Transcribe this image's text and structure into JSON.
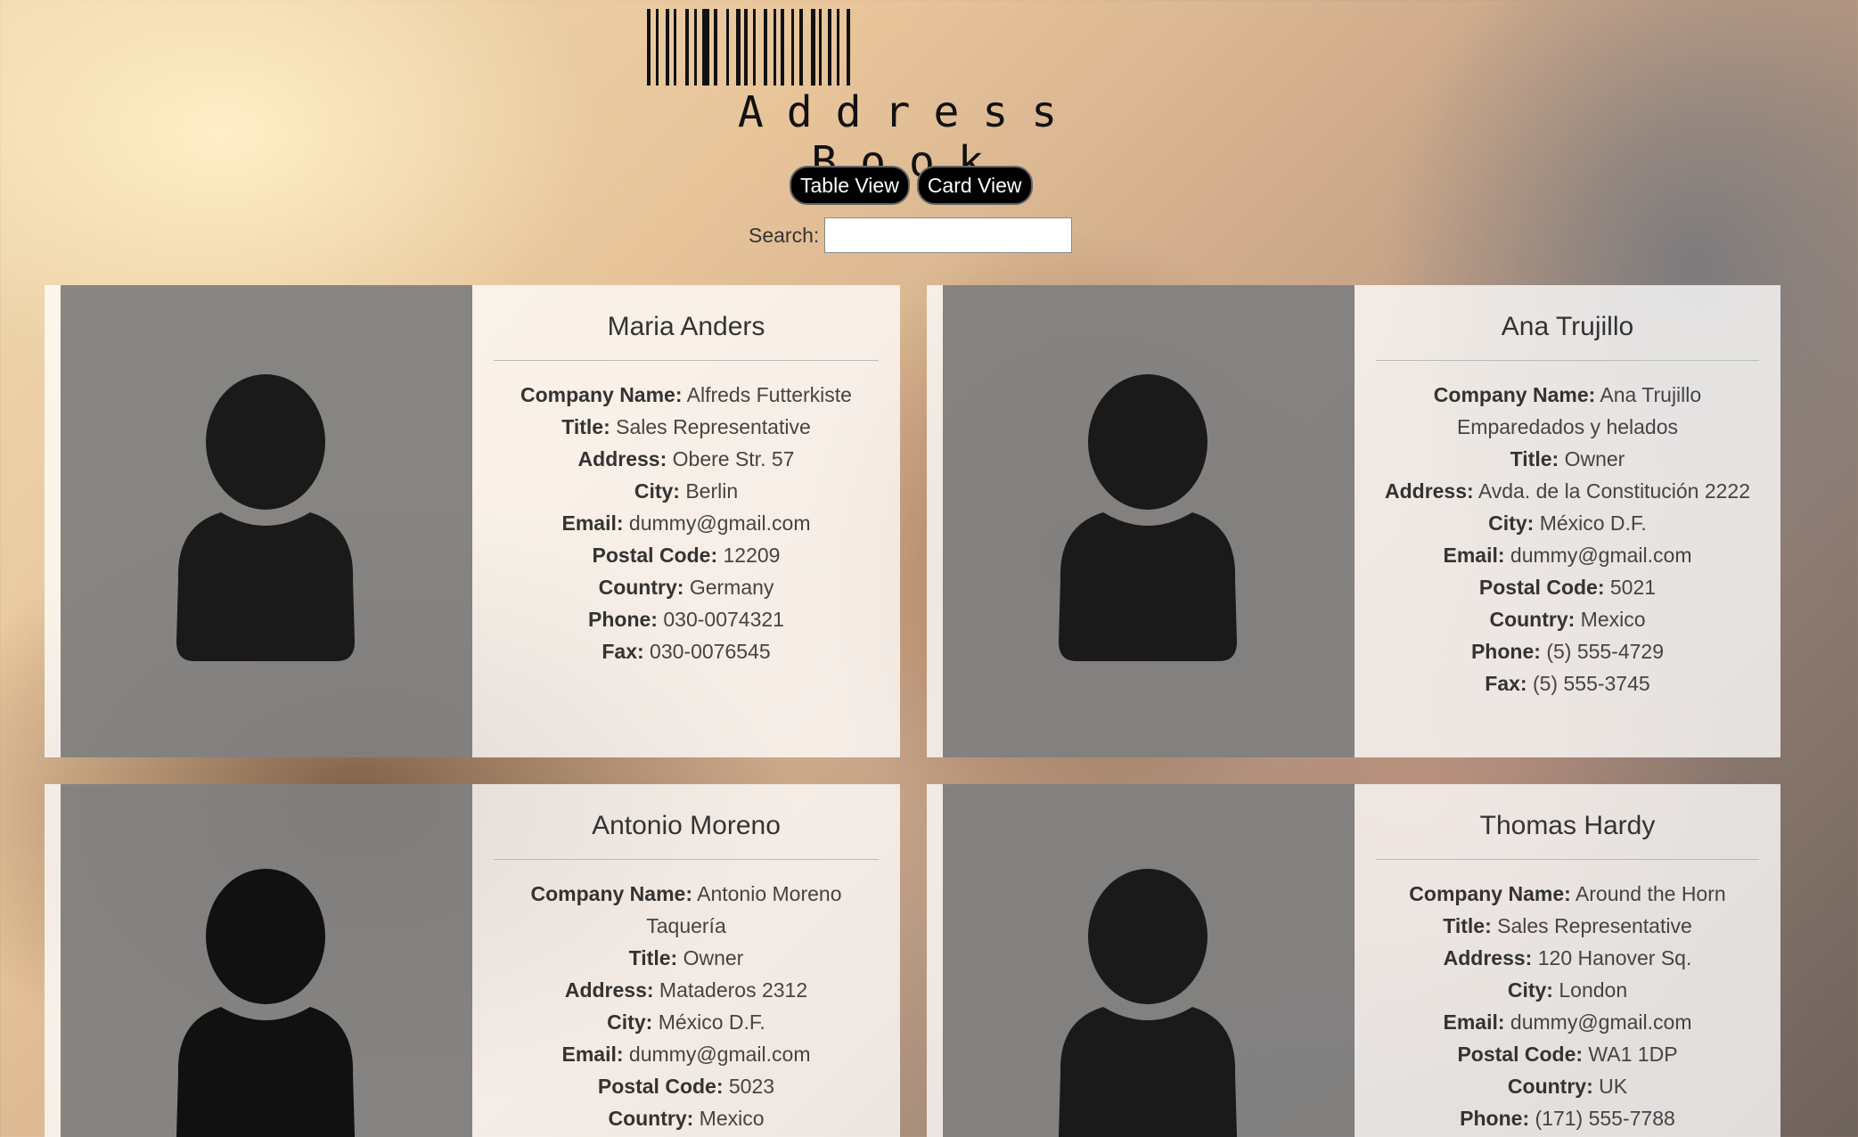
{
  "header": {
    "title": "Address Book"
  },
  "view_buttons": {
    "table_label": "Table View",
    "card_label": "Card View"
  },
  "search": {
    "label": "Search:",
    "value": "",
    "placeholder": ""
  },
  "field_labels": {
    "company": "Company Name:",
    "title": "Title:",
    "address": "Address:",
    "city": "City:",
    "email": "Email:",
    "postal": "Postal Code:",
    "country": "Country:",
    "phone": "Phone:",
    "fax": "Fax:"
  },
  "contacts": [
    {
      "name": "Maria Anders",
      "company": "Alfreds Futterkiste",
      "title": "Sales Representative",
      "address": "Obere Str. 57",
      "city": "Berlin",
      "email": "dummy@gmail.com",
      "postal": "12209",
      "country": "Germany",
      "phone": "030-0074321",
      "fax": "030-0076545"
    },
    {
      "name": "Ana Trujillo",
      "company": "Ana Trujillo Emparedados y helados",
      "title": "Owner",
      "address": "Avda. de la Constitución 2222",
      "city": "México D.F.",
      "email": "dummy@gmail.com",
      "postal": "5021",
      "country": "Mexico",
      "phone": "(5) 555-4729",
      "fax": "(5) 555-3745"
    },
    {
      "name": "Antonio Moreno",
      "company": "Antonio Moreno Taquería",
      "title": "Owner",
      "address": "Mataderos 2312",
      "city": "México D.F.",
      "email": "dummy@gmail.com",
      "postal": "5023",
      "country": "Mexico"
    },
    {
      "name": "Thomas Hardy",
      "company": "Around the Horn",
      "title": "Sales Representative",
      "address": "120 Hanover Sq.",
      "city": "London",
      "email": "dummy@gmail.com",
      "postal": "WA1 1DP",
      "country": "UK",
      "phone": "(171) 555-7788"
    }
  ],
  "icons": {
    "avatar": "user-silhouette-icon",
    "logo": "barcode-logo"
  }
}
